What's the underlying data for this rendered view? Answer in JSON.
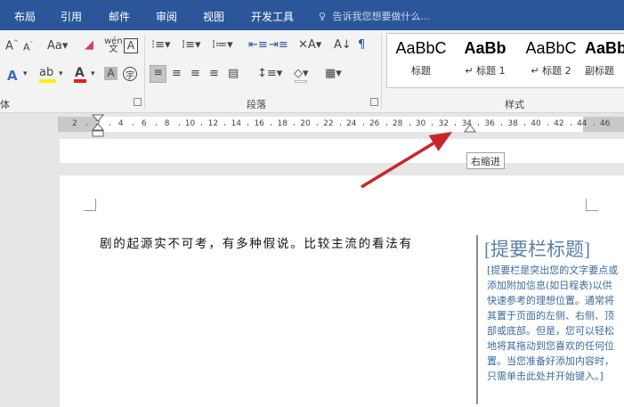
{
  "tabs": [
    {
      "label": "布局"
    },
    {
      "label": "引用"
    },
    {
      "label": "邮件"
    },
    {
      "label": "审阅"
    },
    {
      "label": "视图"
    },
    {
      "label": "开发工具"
    }
  ],
  "tell_me": {
    "placeholder": "告诉我您想要做什么..."
  },
  "ribbon": {
    "groups": {
      "font_partial": "体",
      "paragraph": "段落",
      "styles": "样式"
    },
    "font_size_button": "Aa",
    "styles": [
      {
        "sample": "AaBbC",
        "name": "标题"
      },
      {
        "sample": "AaBb",
        "name": "标题 1"
      },
      {
        "sample": "AaBbC",
        "name": "标题 2"
      },
      {
        "sample": "AaBb",
        "name": "副标题"
      }
    ]
  },
  "ruler": {
    "numbers": [
      "2",
      "2",
      "4",
      "6",
      "8",
      "10",
      "12",
      "14",
      "16",
      "18",
      "20",
      "22",
      "24",
      "26",
      "28",
      "30",
      "32",
      "34",
      "36",
      "38",
      "40",
      "42",
      "44",
      "46"
    ]
  },
  "tooltip": {
    "text": "右缩进"
  },
  "document": {
    "body_text": "剧的起源实不可考，有多种假说。比较主流的看法有",
    "sidebar": {
      "title": "[提要栏标题]",
      "text": "[提要栏是突出您的文字要点或添加附加信息(如日程表)以供快速参考的理想位置。通常将其置于页面的左侧、右侧、顶部或底部。但是，您可以轻松地将其拖动到您喜欢的任何位置。当您准备好添加内容时，只需单击此处并开始键入。]"
    }
  },
  "colors": {
    "ribbon_blue": "#2b579a",
    "arrow_red": "#c8262b",
    "sidebar_text": "#3b6a9e"
  }
}
